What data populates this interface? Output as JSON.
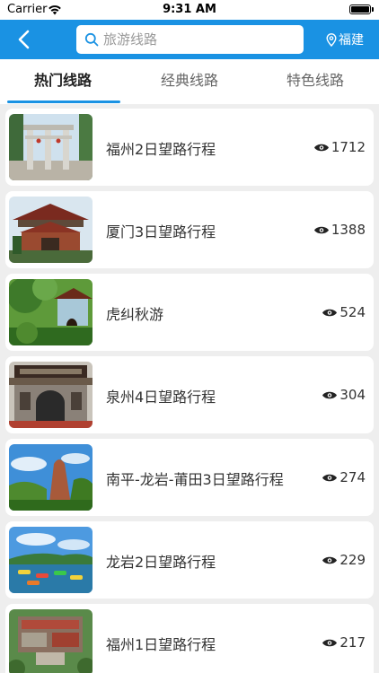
{
  "status_bar": {
    "carrier": "Carrier",
    "time": "9:31 AM"
  },
  "nav": {
    "search_placeholder": "旅游线路",
    "location": "福建"
  },
  "tabs": [
    {
      "label": "热门线路",
      "active": true
    },
    {
      "label": "经典线路",
      "active": false
    },
    {
      "label": "特色线路",
      "active": false
    }
  ],
  "routes": [
    {
      "title": "福州2日望路行程",
      "views": "1712"
    },
    {
      "title": "厦门3日望路行程",
      "views": "1388"
    },
    {
      "title": "虎纠秋游",
      "views": "524"
    },
    {
      "title": "泉州4日望路行程",
      "views": "304"
    },
    {
      "title": "南平-龙岩-莆田3日望路行程",
      "views": "274"
    },
    {
      "title": "龙岩2日望路行程",
      "views": "229"
    },
    {
      "title": "福州1日望路行程",
      "views": "217"
    }
  ],
  "colors": {
    "primary": "#1a92e3",
    "background": "#eeeeee"
  }
}
